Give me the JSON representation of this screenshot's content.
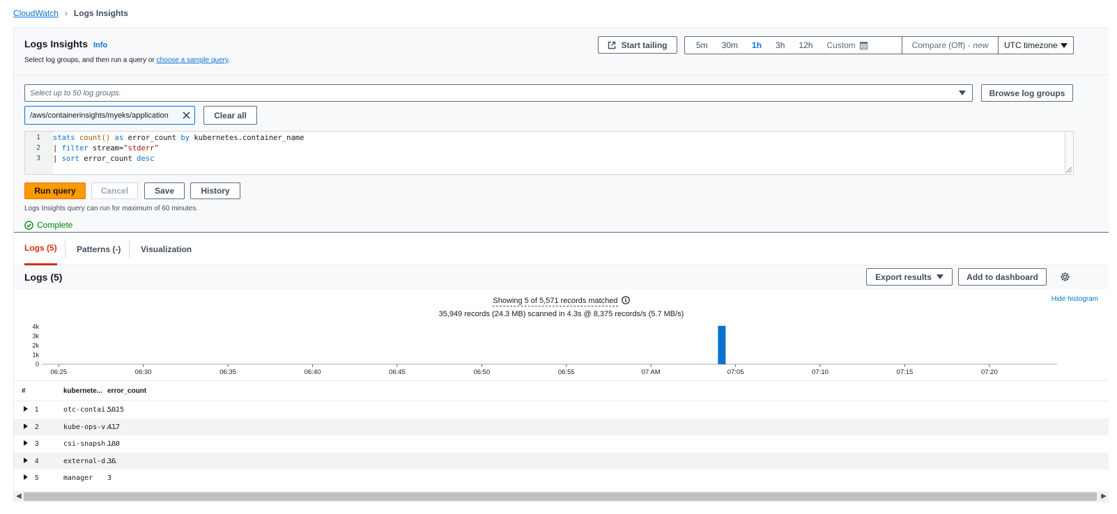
{
  "breadcrumb": {
    "root": "CloudWatch",
    "separator": "›",
    "current": "Logs Insights"
  },
  "header": {
    "title": "Logs Insights",
    "info": "Info",
    "description_prefix": "Select log groups, and then run a query or ",
    "description_link": "choose a sample query",
    "description_suffix": "."
  },
  "toolbar": {
    "start_tailing": "Start tailing",
    "time_options": [
      "5m",
      "30m",
      "1h",
      "3h",
      "12h"
    ],
    "active_time": "1h",
    "custom": "Custom",
    "compare_label": "Compare (Off) -",
    "compare_new": "new",
    "timezone": "UTC timezone"
  },
  "log_groups": {
    "placeholder": "Select up to 50 log groups.",
    "browse": "Browse log groups",
    "selected": "/aws/containerinsights/myeks/application",
    "clear_all": "Clear all"
  },
  "query": {
    "lines": [
      {
        "num": "1"
      },
      {
        "num": "2"
      },
      {
        "num": "3"
      }
    ],
    "line1": {
      "kw1": "stats",
      "fn": "count()",
      "kw2": "as",
      "t1": "error_count",
      "kw3": "by",
      "t2": "kubernetes.container_name"
    },
    "line2": {
      "pipe": "|",
      "kw": "filter",
      "t1": "stream=",
      "str": "\"stderr\""
    },
    "line3": {
      "pipe": "|",
      "kw": "sort",
      "t1": "error_count",
      "kw2": "desc"
    }
  },
  "actions": {
    "run": "Run query",
    "cancel": "Cancel",
    "save": "Save",
    "history": "History"
  },
  "note": "Logs Insights query can run for maximum of 60 minutes.",
  "status": "Complete",
  "tabs": [
    {
      "label": "Logs (5)"
    },
    {
      "label": "Patterns (-)"
    },
    {
      "label": "Visualization"
    }
  ],
  "logs": {
    "title": "Logs (5)",
    "export": "Export results",
    "add_dashboard": "Add to dashboard",
    "summary": "Showing 5 of 5,571 records matched",
    "scanned": "35,949 records (24.3 MB) scanned in 4.3s @ 8,375 records/s (5.7 MB/s)",
    "hide_histogram": "Hide histogram"
  },
  "chart_data": {
    "type": "bar",
    "x": [
      "06:25",
      "06:30",
      "06:35",
      "06:40",
      "06:45",
      "06:50",
      "06:55",
      "07 AM",
      "07:05",
      "07:10",
      "07:15",
      "07:20"
    ],
    "y_ticks": [
      "4k",
      "3k",
      "2k",
      "1k",
      "0"
    ],
    "ylim": [
      0,
      4500
    ],
    "bars": [
      {
        "time_minute": "07:04",
        "value": 4600
      }
    ],
    "accent": "#0972d3"
  },
  "table": {
    "headers": {
      "num": "#",
      "col1": "kubernete...",
      "col2": "error_count"
    },
    "rows": [
      {
        "n": "1",
        "name": "otc-contai...",
        "count": "5015"
      },
      {
        "n": "2",
        "name": "kube-ops-v...",
        "count": "417"
      },
      {
        "n": "3",
        "name": "csi-snapsh...",
        "count": "100"
      },
      {
        "n": "4",
        "name": "external-d...",
        "count": "36"
      },
      {
        "n": "5",
        "name": "manager",
        "count": "3"
      }
    ]
  }
}
